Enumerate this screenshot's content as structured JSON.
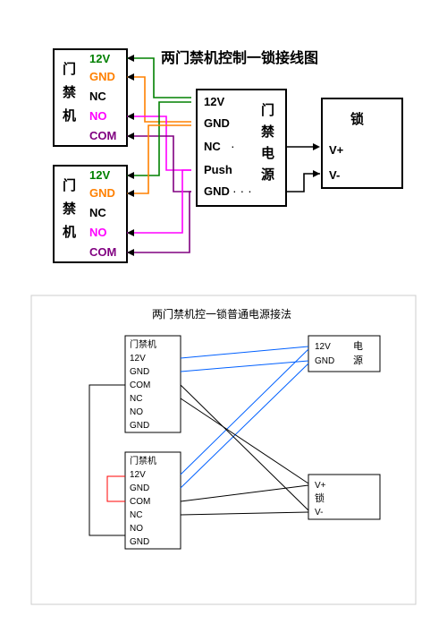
{
  "diagram1": {
    "title": "两门禁机控制一锁接线图",
    "reader_label": "门禁机",
    "controller_label": "门禁电源",
    "lock_label": "锁",
    "reader_pins": [
      "12V",
      "GND",
      "NC",
      "NO",
      "COM"
    ],
    "reader_pin_colors": [
      "#008000",
      "#ff8000",
      "#000",
      "#ff00ff",
      "#800080"
    ],
    "controller_pins": [
      "12V",
      "GND",
      "NC",
      "Push",
      "GND"
    ],
    "lock_pins": [
      "V+",
      "V-"
    ]
  },
  "diagram2": {
    "title": "两门禁机控一锁普通电源接法",
    "reader_label": "门禁机",
    "psu_lines": [
      "12V",
      "GND"
    ],
    "psu_label": "电源",
    "lock_lines": [
      "V+",
      "V-"
    ],
    "lock_label": "锁",
    "reader_pins": [
      "12V",
      "GND",
      "COM",
      "NC",
      "NO",
      "GND"
    ]
  }
}
